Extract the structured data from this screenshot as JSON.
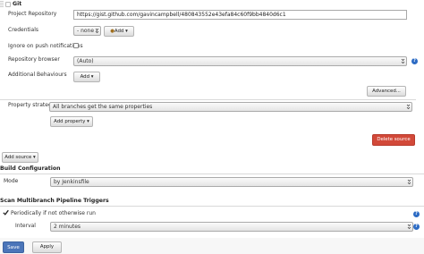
{
  "git": {
    "section_label": "Git",
    "project_repository": {
      "label": "Project Repository",
      "value": "https://gist.github.com/gavincampbell/480843552e43efa84c60f9bb4840d6c1"
    },
    "credentials": {
      "label": "Credentials",
      "selected": "- none -",
      "add_label": "Add"
    },
    "ignore_push": {
      "label": "Ignore on push notifications",
      "checked": false
    },
    "repository_browser": {
      "label": "Repository browser",
      "selected": "(Auto)"
    },
    "additional_behaviours": {
      "label": "Additional Behaviours",
      "add_label": "Add"
    },
    "advanced_label": "Advanced...",
    "property_strategy": {
      "label": "Property strategy",
      "selected": "All branches get the same properties",
      "add_property_label": "Add property"
    },
    "delete_source_label": "Delete source"
  },
  "add_source_label": "Add source",
  "build_configuration": {
    "title": "Build Configuration",
    "mode_label": "Mode",
    "mode_selected": "by Jenkinsfile"
  },
  "scan_triggers": {
    "title": "Scan Multibranch Pipeline Triggers",
    "periodically": {
      "label": "Periodically if not otherwise run",
      "checked": true
    },
    "interval_label": "Interval",
    "interval_selected": "2 minutes"
  },
  "footer": {
    "save_label": "Save",
    "apply_label": "Apply"
  },
  "colors": {
    "help_icon": "#2c6bc4",
    "delete_button": "#d24939",
    "save_button": "#4b75b9"
  },
  "icons": [
    "drag-handle-icon",
    "help-icon",
    "dropdown-caret-icon",
    "checkbox-icon"
  ]
}
